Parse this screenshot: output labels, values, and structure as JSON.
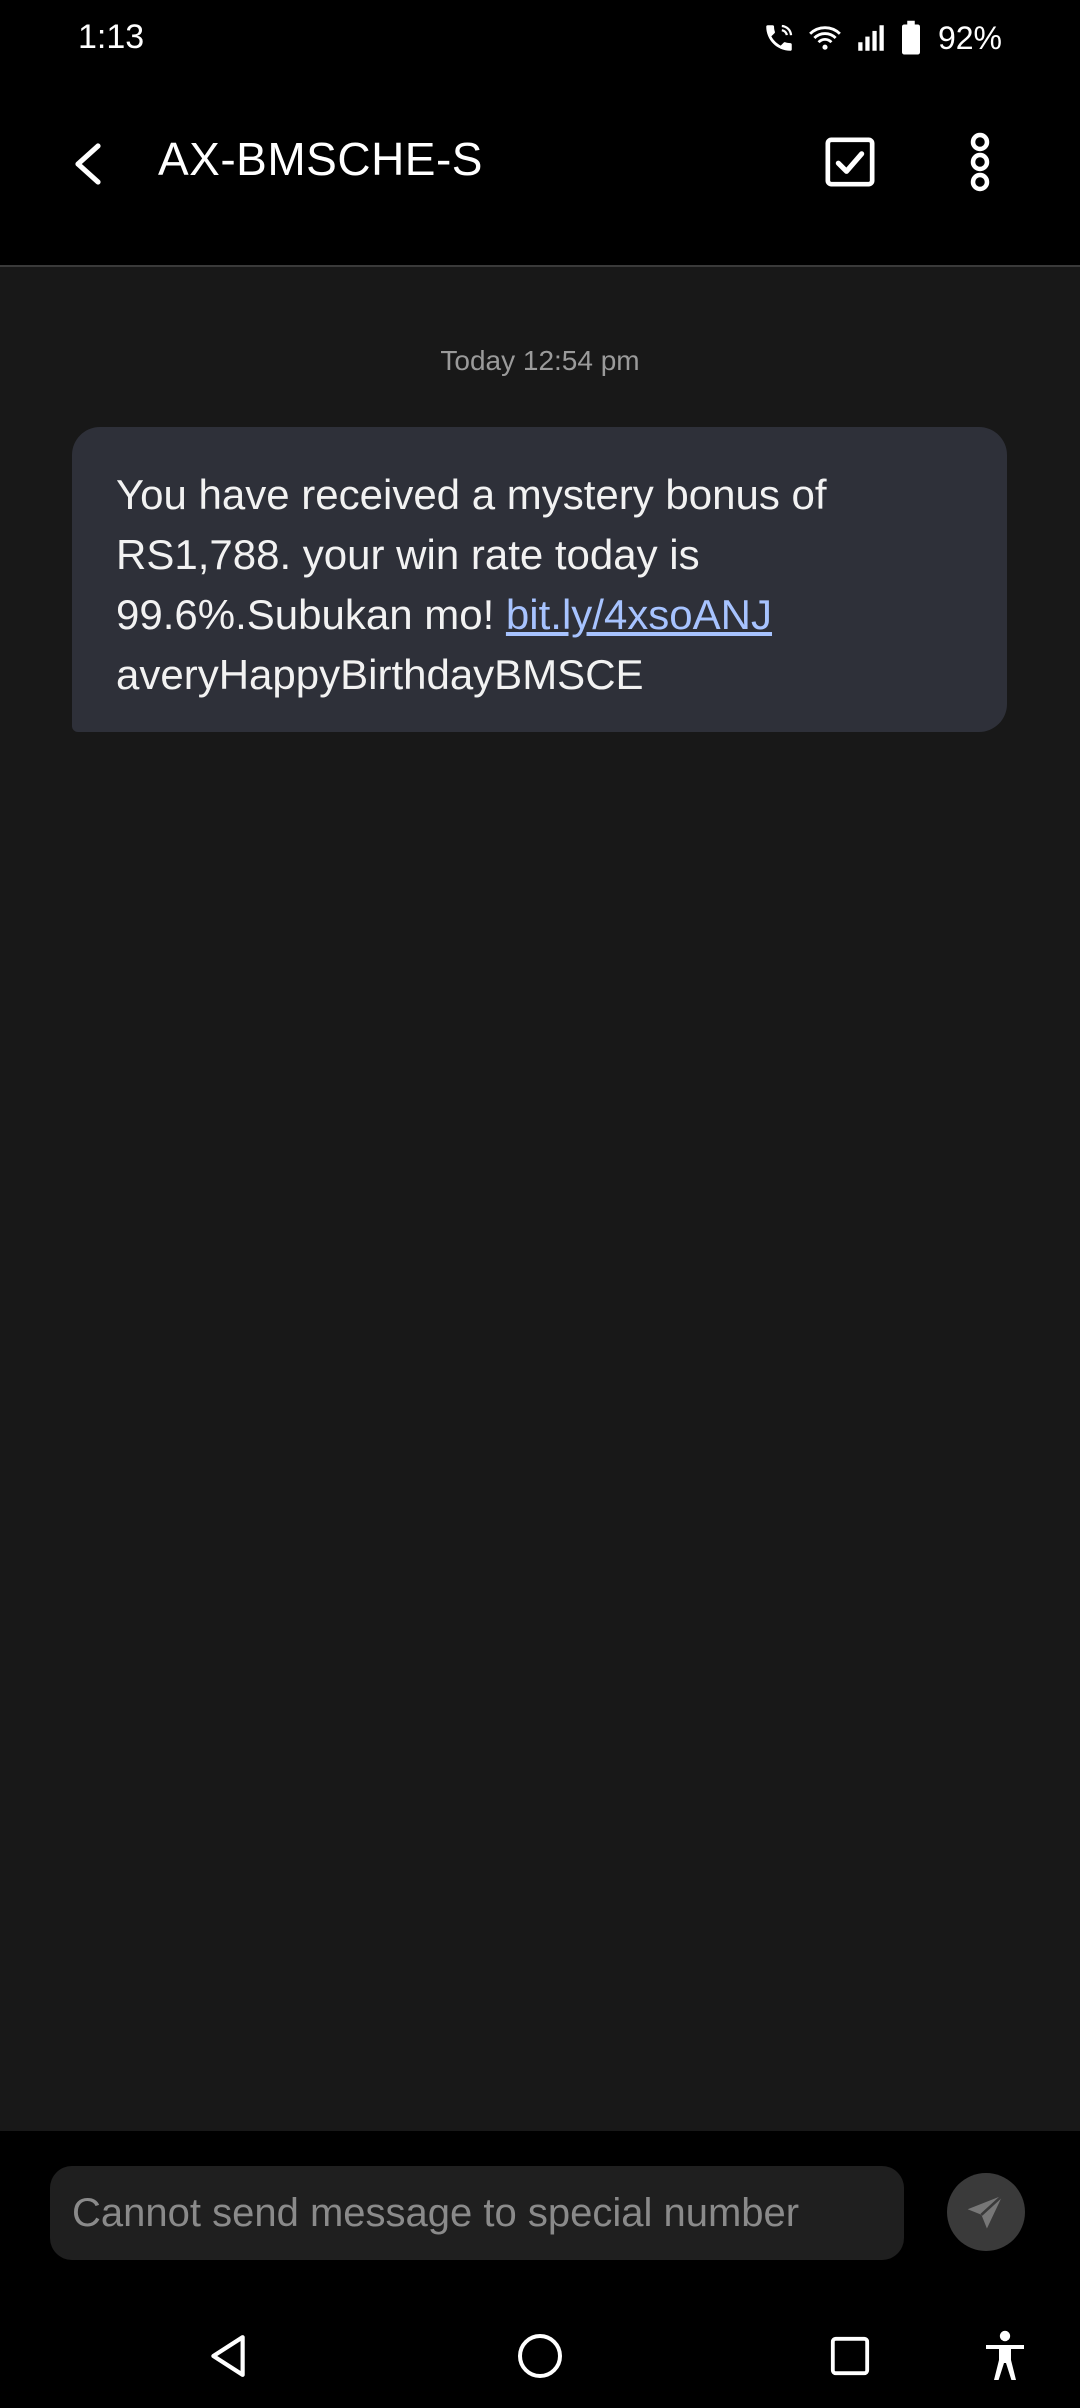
{
  "status_bar": {
    "time": "1:13",
    "battery_percent": "92%",
    "icons": [
      "wifi-calling-icon",
      "wifi-icon",
      "signal-icon",
      "battery-icon"
    ]
  },
  "app_bar": {
    "title": "AX-BMSCHE-S",
    "icons": [
      "back-arrow-icon",
      "select-checkbox-icon",
      "more-vertical-icon"
    ]
  },
  "conversation": {
    "timestamp": "Today 12:54 pm",
    "message": {
      "text_before_link": "You have received a mystery bonus of RS1,788. your win rate today is 99.6%.Subukan mo! ",
      "link": "bit.ly/4xsoANJ",
      "text_after_link": "averyHappyBirthdayBMSCE"
    }
  },
  "composer": {
    "placeholder": "Cannot send message to special number",
    "send_icon": "send-icon"
  },
  "nav_bar": {
    "icons": [
      "nav-back-icon",
      "nav-home-icon",
      "nav-recents-icon",
      "accessibility-icon"
    ]
  },
  "colors": {
    "background": "#000000",
    "conversation_bg": "#181818",
    "bubble_bg": "#2e3039",
    "link": "#a7c3ff",
    "timestamp": "#9a9a9a"
  }
}
